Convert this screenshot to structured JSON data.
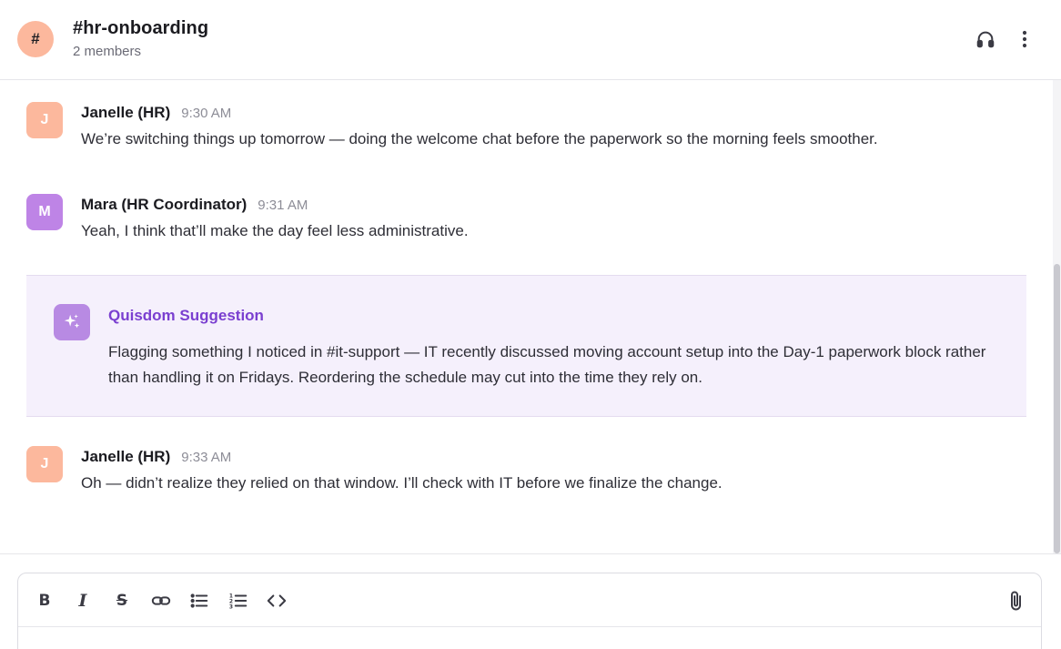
{
  "header": {
    "channel_icon": "#",
    "title": "#hr-onboarding",
    "members": "2 members",
    "icons": [
      "headphones-icon",
      "more-vertical-icon"
    ]
  },
  "messages": [
    {
      "avatar_letter": "J",
      "author": "Janelle (HR)",
      "time": "9:30 AM",
      "text": "We’re switching things up tomorrow — doing the welcome chat before the paperwork so the morning feels smoother."
    },
    {
      "avatar_letter": "M",
      "author": "Mara (HR Coordinator)",
      "time": "9:31 AM",
      "text": "Yeah, I think that’ll make the day feel less administrative."
    },
    {
      "avatar_letter": "J",
      "author": "Janelle (HR)",
      "time": "9:33 AM",
      "text": "Oh — didn’t realize they relied on that window. I’ll check with IT before we finalize the change."
    }
  ],
  "suggestion": {
    "title": "Quisdom Suggestion",
    "text": "Flagging something I noticed in #it-support — IT recently discussed moving account setup into the Day-1 paperwork block rather than handling it on Fridays. Reordering the schedule may cut into the time they rely on.",
    "icon": "sparkles-icon"
  },
  "composer": {
    "toolbar": {
      "bold": "B",
      "italic": "I",
      "strike": "S"
    },
    "toolbar_icons": [
      "bold-icon",
      "italic-icon",
      "strikethrough-icon",
      "link-icon",
      "bulleted-list-icon",
      "numbered-list-icon",
      "code-icon",
      "attach-icon"
    ]
  },
  "colors": {
    "peach_avatar": "#fcb89d",
    "purple_avatar": "#be84e6",
    "suggestion_bg": "#f5f0fc",
    "suggestion_title": "#7a3fd0"
  }
}
